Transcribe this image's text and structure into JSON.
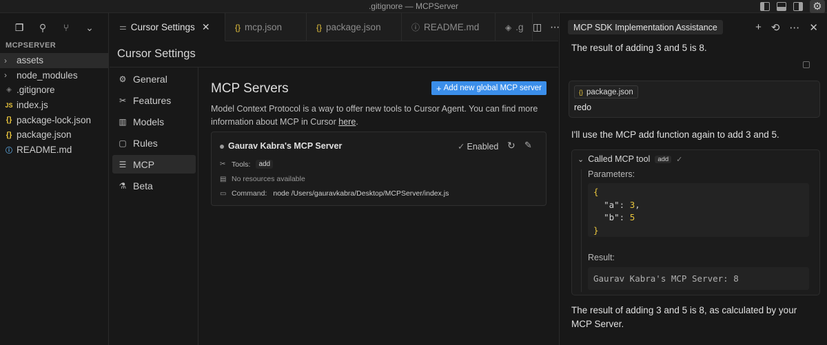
{
  "window": {
    "title": ".gitignore — MCPServer"
  },
  "titlebar_icons": [
    "toggle-primary-sidebar-icon",
    "toggle-panel-icon",
    "toggle-secondary-sidebar-icon",
    "gear-icon"
  ],
  "explorer": {
    "toolbar_icons": [
      "files-icon",
      "search-icon",
      "source-control-icon",
      "chevron-down-icon"
    ],
    "section_title": "MCPSERVER",
    "items": [
      {
        "label": "assets",
        "type": "folder",
        "selected": true
      },
      {
        "label": "node_modules",
        "type": "folder",
        "selected": false
      },
      {
        "label": ".gitignore",
        "type": "git",
        "selected": false
      },
      {
        "label": "index.js",
        "type": "js",
        "selected": false
      },
      {
        "label": "package-lock.json",
        "type": "json",
        "selected": false
      },
      {
        "label": "package.json",
        "type": "json",
        "selected": false
      },
      {
        "label": "README.md",
        "type": "info",
        "selected": false
      }
    ],
    "icon_glyphs": {
      "js": "JS",
      "json": "{}",
      "git": "◈",
      "info": "ⓘ",
      "folder": "›"
    }
  },
  "tabs": [
    {
      "label": "Cursor Settings",
      "icon": "⚌",
      "active": true,
      "closable": true
    },
    {
      "label": "mcp.json",
      "icon": "{}",
      "active": false
    },
    {
      "label": "package.json",
      "icon": "{}",
      "active": false
    },
    {
      "label": "README.md",
      "icon": "ⓘ",
      "active": false
    },
    {
      "label": ".g",
      "icon": "◈",
      "active": false
    }
  ],
  "settings": {
    "title": "Cursor Settings",
    "nav": [
      {
        "label": "General",
        "icon": "⚙",
        "active": false
      },
      {
        "label": "Features",
        "icon": "✂",
        "active": false
      },
      {
        "label": "Models",
        "icon": "▥",
        "active": false
      },
      {
        "label": "Rules",
        "icon": "▢",
        "active": false
      },
      {
        "label": "MCP",
        "icon": "☰",
        "active": true
      },
      {
        "label": "Beta",
        "icon": "⚗",
        "active": false
      }
    ],
    "mcp": {
      "heading": "MCP Servers",
      "add_button": "Add new global MCP server",
      "description": "Model Context Protocol is a way to offer new tools to Cursor Agent. You can find more information about MCP in Cursor",
      "description_link": "here",
      "server": {
        "name": "Gaurav Kabra's MCP Server",
        "status": "Enabled",
        "tools_label": "Tools:",
        "tools": [
          "add"
        ],
        "resources_text": "No resources available",
        "command_label": "Command:",
        "command": "node /Users/gauravkabra/Desktop/MCPServer/index.js"
      }
    }
  },
  "chat": {
    "tab_title": "MCP SDK Implementation Assistance",
    "header_icons": [
      "plus-icon",
      "history-icon",
      "more-icon",
      "close-icon"
    ],
    "messages": {
      "assistant_1": "The result of adding 3 and 5 is 8.",
      "user_file_chip": "package.json",
      "user_text": "redo",
      "assistant_2": "I'll use the MCP add function again to add 3 and 5.",
      "tool_call": {
        "title": "Called MCP tool",
        "tool_name": "add",
        "parameters_label": "Parameters:",
        "params": {
          "a": "3",
          "b": "5"
        },
        "result_label": "Result:",
        "result": "Gaurav Kabra's MCP Server: 8"
      },
      "assistant_3_line1": "The result of adding 3 and 5 is 8, as calculated by your",
      "assistant_3_line2": "MCP Server."
    }
  },
  "colors": {
    "accent": "#3b8eea",
    "json_icon": "#e9c53d",
    "background": "#181818"
  }
}
